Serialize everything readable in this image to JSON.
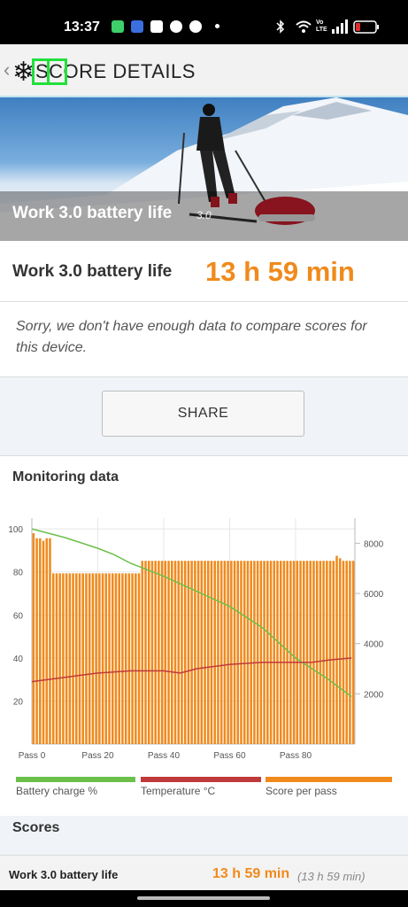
{
  "status_bar": {
    "time": "13:37"
  },
  "app_bar": {
    "back_glyph": "‹",
    "title": "SCORE DETAILS"
  },
  "hero": {
    "title": "Work 3.0 battery life",
    "version": "3.0"
  },
  "score": {
    "label": "Work 3.0 battery life",
    "value": "13 h 59 min"
  },
  "notice": {
    "text": "Sorry, we don't have enough data to compare scores for this device."
  },
  "share_button": {
    "label": "SHARE"
  },
  "monitoring": {
    "title": "Monitoring data",
    "legend": [
      {
        "label": "Battery charge %",
        "color": "#6cc04a"
      },
      {
        "label": "Temperature °C",
        "color": "#c0393b"
      },
      {
        "label": "Score per pass",
        "color": "#f08a1c"
      }
    ]
  },
  "chart_data": {
    "type": "bar",
    "x_ticks": [
      "Pass 0",
      "Pass 20",
      "Pass 40",
      "Pass 60",
      "Pass 80"
    ],
    "x_tick_positions": [
      0,
      20,
      40,
      60,
      80
    ],
    "xlim": [
      0,
      98
    ],
    "y_left_ticks": [
      "100",
      "80",
      "60",
      "40",
      "20"
    ],
    "y_left_tick_values": [
      100,
      80,
      60,
      40,
      20
    ],
    "ylim_left": [
      0,
      105
    ],
    "y_right_ticks": [
      "8000",
      "6000",
      "4000",
      "2000"
    ],
    "y_right_tick_values": [
      8000,
      6000,
      4000,
      2000
    ],
    "ylim_right": [
      0,
      9000
    ],
    "grid": true,
    "series": [
      {
        "name": "Score per pass",
        "axis": "right",
        "values": [
          8400,
          8200,
          8200,
          8100,
          8200,
          8200,
          6800,
          6800,
          6800,
          6800,
          6800,
          6800,
          6800,
          6800,
          6800,
          6800,
          6800,
          6800,
          6800,
          6800,
          6800,
          6800,
          6800,
          6800,
          6800,
          6800,
          6800,
          6800,
          6800,
          6800,
          6800,
          6800,
          6800,
          7300,
          7300,
          7300,
          7300,
          7300,
          7300,
          7300,
          7300,
          7300,
          7300,
          7300,
          7300,
          7300,
          7300,
          7300,
          7300,
          7300,
          7300,
          7300,
          7300,
          7300,
          7300,
          7300,
          7300,
          7300,
          7300,
          7300,
          7300,
          7300,
          7300,
          7300,
          7300,
          7300,
          7300,
          7300,
          7300,
          7300,
          7300,
          7300,
          7300,
          7300,
          7300,
          7300,
          7300,
          7300,
          7300,
          7300,
          7300,
          7300,
          7300,
          7300,
          7300,
          7300,
          7300,
          7300,
          7300,
          7300,
          7300,
          7300,
          7500,
          7400,
          7300,
          7300,
          7300,
          7300
        ]
      },
      {
        "name": "Battery charge %",
        "axis": "left",
        "x": [
          0,
          10,
          20,
          25,
          30,
          40,
          50,
          60,
          70,
          80,
          90,
          97
        ],
        "y": [
          100,
          96,
          91,
          88,
          84,
          78,
          71,
          64,
          54,
          40,
          30,
          22
        ]
      },
      {
        "name": "Temperature °C",
        "axis": "left",
        "x": [
          0,
          5,
          10,
          15,
          20,
          30,
          40,
          45,
          50,
          60,
          70,
          80,
          85,
          90,
          97
        ],
        "y": [
          29,
          30,
          31,
          32,
          33,
          34,
          34,
          33,
          35,
          37,
          38,
          38,
          38,
          39,
          40
        ]
      }
    ]
  },
  "scores": {
    "title": "Scores",
    "rows": [
      {
        "name": "Work 3.0 battery life",
        "value": "13 h 59 min",
        "sub": "(13 h 59 min)"
      }
    ]
  }
}
